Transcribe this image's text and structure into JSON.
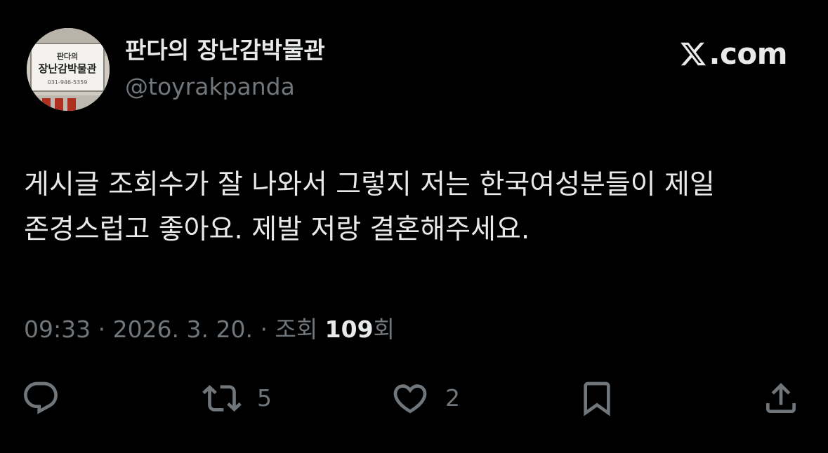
{
  "profile": {
    "display_name": "판다의 장난감박물관",
    "handle": "@toyrakpanda",
    "avatar": {
      "sign_line1": "판다의",
      "sign_line2": "장난감박물관",
      "sign_phone": "031-946-5359"
    }
  },
  "brand": {
    "label": ".com",
    "icon": "x-logo-icon"
  },
  "tweet": {
    "line1": "게시글 조회수가 잘 나와서 그렇지 저는 한국여성분들이 제일",
    "line2": "존경스럽고 좋아요. 제발 저랑 결혼해주세요."
  },
  "meta": {
    "time_date": "09:33 · 2026. 3. 20. · 조회 ",
    "views_count": "109",
    "views_suffix": "회"
  },
  "actions": {
    "reply": {
      "icon": "reply-icon"
    },
    "retweet": {
      "icon": "retweet-icon",
      "count": "5"
    },
    "like": {
      "icon": "heart-icon",
      "count": "2"
    },
    "bookmark": {
      "icon": "bookmark-icon"
    },
    "share": {
      "icon": "share-icon"
    }
  },
  "colors": {
    "background": "#000000",
    "primary_text": "#e7e9ea",
    "secondary_text": "#71767b"
  }
}
